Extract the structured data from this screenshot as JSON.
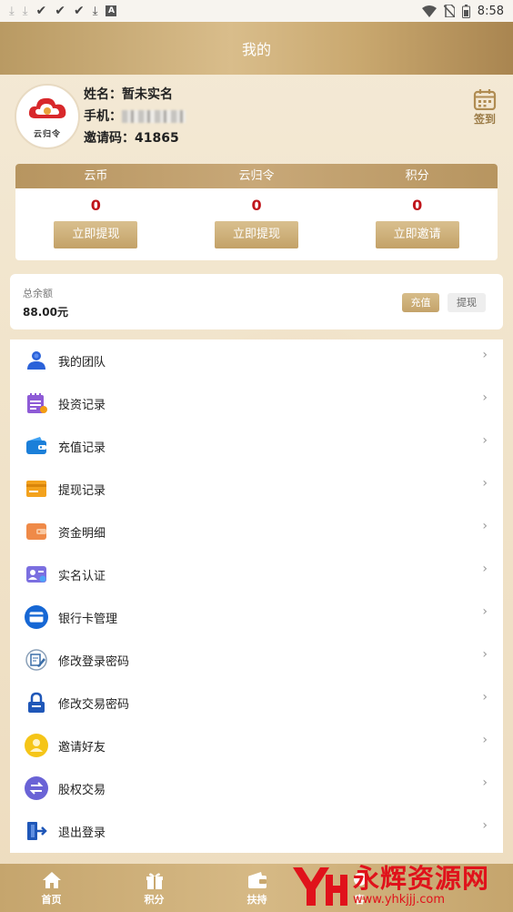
{
  "status_bar": {
    "time": "8:58",
    "notification_icons": [
      "download-icon",
      "download-icon",
      "check-icon",
      "check-icon",
      "check-icon",
      "download-icon",
      "a-icon"
    ]
  },
  "header": {
    "title": "我的"
  },
  "profile": {
    "name_label": "姓名：",
    "name_value": "暂未实名",
    "phone_label": "手机：",
    "invite_label": "邀请码：",
    "invite_value": "41865",
    "logo_text": "云归令",
    "signin_label": "签到"
  },
  "wallet": {
    "columns": [
      {
        "title": "云币",
        "value": "0",
        "button": "立即提现"
      },
      {
        "title": "云归令",
        "value": "0",
        "button": "立即提现"
      },
      {
        "title": "积分",
        "value": "0",
        "button": "立即邀请"
      }
    ]
  },
  "balance": {
    "label": "总余额",
    "value": "88.00元",
    "recharge_label": "充值",
    "withdraw_label": "提现"
  },
  "menu": {
    "items": [
      {
        "label": "我的团队",
        "icon": "team-icon"
      },
      {
        "label": "投资记录",
        "icon": "notepad-icon"
      },
      {
        "label": "充值记录",
        "icon": "wallet-icon"
      },
      {
        "label": "提现记录",
        "icon": "card-icon"
      },
      {
        "label": "资金明细",
        "icon": "purse-icon"
      },
      {
        "label": "实名认证",
        "icon": "id-card-icon"
      },
      {
        "label": "银行卡管理",
        "icon": "bank-card-icon"
      },
      {
        "label": "修改登录密码",
        "icon": "edit-doc-icon"
      },
      {
        "label": "修改交易密码",
        "icon": "lock-icon"
      },
      {
        "label": "邀请好友",
        "icon": "friend-icon"
      },
      {
        "label": "股权交易",
        "icon": "exchange-icon"
      },
      {
        "label": "退出登录",
        "icon": "logout-icon"
      }
    ]
  },
  "tabbar": {
    "tabs": [
      {
        "label": "首页",
        "icon": "home-icon"
      },
      {
        "label": "积分",
        "icon": "gift-icon"
      },
      {
        "label": "扶持",
        "icon": "wallet-icon"
      },
      {
        "label": "客",
        "icon": "service-icon"
      }
    ]
  },
  "watermark": {
    "text": "永辉资源网",
    "url": "www.yhkjjj.com"
  },
  "colors": {
    "gold": "#c3a167",
    "red": "#c0161c",
    "header_gold": "#d9bd8b"
  }
}
